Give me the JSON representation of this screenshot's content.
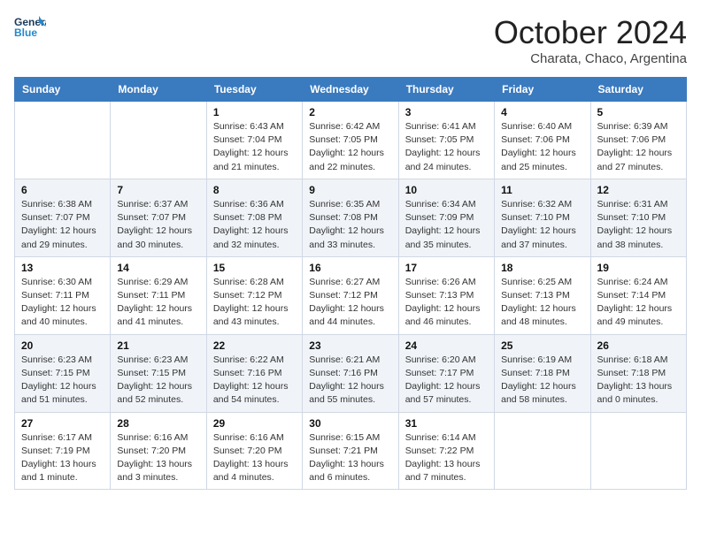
{
  "logo": {
    "general": "General",
    "blue": "Blue"
  },
  "title": "October 2024",
  "location": "Charata, Chaco, Argentina",
  "days_of_week": [
    "Sunday",
    "Monday",
    "Tuesday",
    "Wednesday",
    "Thursday",
    "Friday",
    "Saturday"
  ],
  "weeks": [
    [
      {
        "day": "",
        "info": ""
      },
      {
        "day": "",
        "info": ""
      },
      {
        "day": "1",
        "info": "Sunrise: 6:43 AM\nSunset: 7:04 PM\nDaylight: 12 hours and 21 minutes."
      },
      {
        "day": "2",
        "info": "Sunrise: 6:42 AM\nSunset: 7:05 PM\nDaylight: 12 hours and 22 minutes."
      },
      {
        "day": "3",
        "info": "Sunrise: 6:41 AM\nSunset: 7:05 PM\nDaylight: 12 hours and 24 minutes."
      },
      {
        "day": "4",
        "info": "Sunrise: 6:40 AM\nSunset: 7:06 PM\nDaylight: 12 hours and 25 minutes."
      },
      {
        "day": "5",
        "info": "Sunrise: 6:39 AM\nSunset: 7:06 PM\nDaylight: 12 hours and 27 minutes."
      }
    ],
    [
      {
        "day": "6",
        "info": "Sunrise: 6:38 AM\nSunset: 7:07 PM\nDaylight: 12 hours and 29 minutes."
      },
      {
        "day": "7",
        "info": "Sunrise: 6:37 AM\nSunset: 7:07 PM\nDaylight: 12 hours and 30 minutes."
      },
      {
        "day": "8",
        "info": "Sunrise: 6:36 AM\nSunset: 7:08 PM\nDaylight: 12 hours and 32 minutes."
      },
      {
        "day": "9",
        "info": "Sunrise: 6:35 AM\nSunset: 7:08 PM\nDaylight: 12 hours and 33 minutes."
      },
      {
        "day": "10",
        "info": "Sunrise: 6:34 AM\nSunset: 7:09 PM\nDaylight: 12 hours and 35 minutes."
      },
      {
        "day": "11",
        "info": "Sunrise: 6:32 AM\nSunset: 7:10 PM\nDaylight: 12 hours and 37 minutes."
      },
      {
        "day": "12",
        "info": "Sunrise: 6:31 AM\nSunset: 7:10 PM\nDaylight: 12 hours and 38 minutes."
      }
    ],
    [
      {
        "day": "13",
        "info": "Sunrise: 6:30 AM\nSunset: 7:11 PM\nDaylight: 12 hours and 40 minutes."
      },
      {
        "day": "14",
        "info": "Sunrise: 6:29 AM\nSunset: 7:11 PM\nDaylight: 12 hours and 41 minutes."
      },
      {
        "day": "15",
        "info": "Sunrise: 6:28 AM\nSunset: 7:12 PM\nDaylight: 12 hours and 43 minutes."
      },
      {
        "day": "16",
        "info": "Sunrise: 6:27 AM\nSunset: 7:12 PM\nDaylight: 12 hours and 44 minutes."
      },
      {
        "day": "17",
        "info": "Sunrise: 6:26 AM\nSunset: 7:13 PM\nDaylight: 12 hours and 46 minutes."
      },
      {
        "day": "18",
        "info": "Sunrise: 6:25 AM\nSunset: 7:13 PM\nDaylight: 12 hours and 48 minutes."
      },
      {
        "day": "19",
        "info": "Sunrise: 6:24 AM\nSunset: 7:14 PM\nDaylight: 12 hours and 49 minutes."
      }
    ],
    [
      {
        "day": "20",
        "info": "Sunrise: 6:23 AM\nSunset: 7:15 PM\nDaylight: 12 hours and 51 minutes."
      },
      {
        "day": "21",
        "info": "Sunrise: 6:23 AM\nSunset: 7:15 PM\nDaylight: 12 hours and 52 minutes."
      },
      {
        "day": "22",
        "info": "Sunrise: 6:22 AM\nSunset: 7:16 PM\nDaylight: 12 hours and 54 minutes."
      },
      {
        "day": "23",
        "info": "Sunrise: 6:21 AM\nSunset: 7:16 PM\nDaylight: 12 hours and 55 minutes."
      },
      {
        "day": "24",
        "info": "Sunrise: 6:20 AM\nSunset: 7:17 PM\nDaylight: 12 hours and 57 minutes."
      },
      {
        "day": "25",
        "info": "Sunrise: 6:19 AM\nSunset: 7:18 PM\nDaylight: 12 hours and 58 minutes."
      },
      {
        "day": "26",
        "info": "Sunrise: 6:18 AM\nSunset: 7:18 PM\nDaylight: 13 hours and 0 minutes."
      }
    ],
    [
      {
        "day": "27",
        "info": "Sunrise: 6:17 AM\nSunset: 7:19 PM\nDaylight: 13 hours and 1 minute."
      },
      {
        "day": "28",
        "info": "Sunrise: 6:16 AM\nSunset: 7:20 PM\nDaylight: 13 hours and 3 minutes."
      },
      {
        "day": "29",
        "info": "Sunrise: 6:16 AM\nSunset: 7:20 PM\nDaylight: 13 hours and 4 minutes."
      },
      {
        "day": "30",
        "info": "Sunrise: 6:15 AM\nSunset: 7:21 PM\nDaylight: 13 hours and 6 minutes."
      },
      {
        "day": "31",
        "info": "Sunrise: 6:14 AM\nSunset: 7:22 PM\nDaylight: 13 hours and 7 minutes."
      },
      {
        "day": "",
        "info": ""
      },
      {
        "day": "",
        "info": ""
      }
    ]
  ]
}
